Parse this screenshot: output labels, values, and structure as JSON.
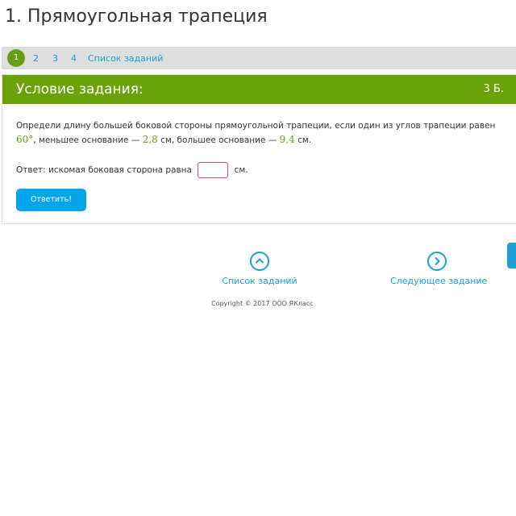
{
  "page": {
    "title": "1. Прямоугольная трапеция"
  },
  "tabs": {
    "current": "1",
    "numbers": [
      "2",
      "3",
      "4"
    ],
    "list_label": "Список заданий"
  },
  "task": {
    "header_title": "Условие задания:",
    "points": "3 Б.",
    "text_part1": "Определи длину большей боковой стороны прямоугольной трапеции, если один из углов трапеции равен",
    "angle": "60°",
    "text_part2": ", меньшее основание —",
    "small_base": "2,8",
    "text_part3": "см, большее основание —",
    "big_base": "9,4",
    "text_part4": "см.",
    "answer_label": "Ответ: искомая боковая сторона равна",
    "answer_unit": "см.",
    "answer_value": "",
    "submit_label": "Ответить!"
  },
  "bottom_nav": {
    "list_label": "Список заданий",
    "next_label": "Следующее задание"
  },
  "footer": {
    "copyright": "Copyright © 2017 ООО ЯКласс"
  },
  "colors": {
    "accent_green": "#6aa20a",
    "link_blue": "#1aa0d8",
    "button_blue": "#04a5ea"
  }
}
